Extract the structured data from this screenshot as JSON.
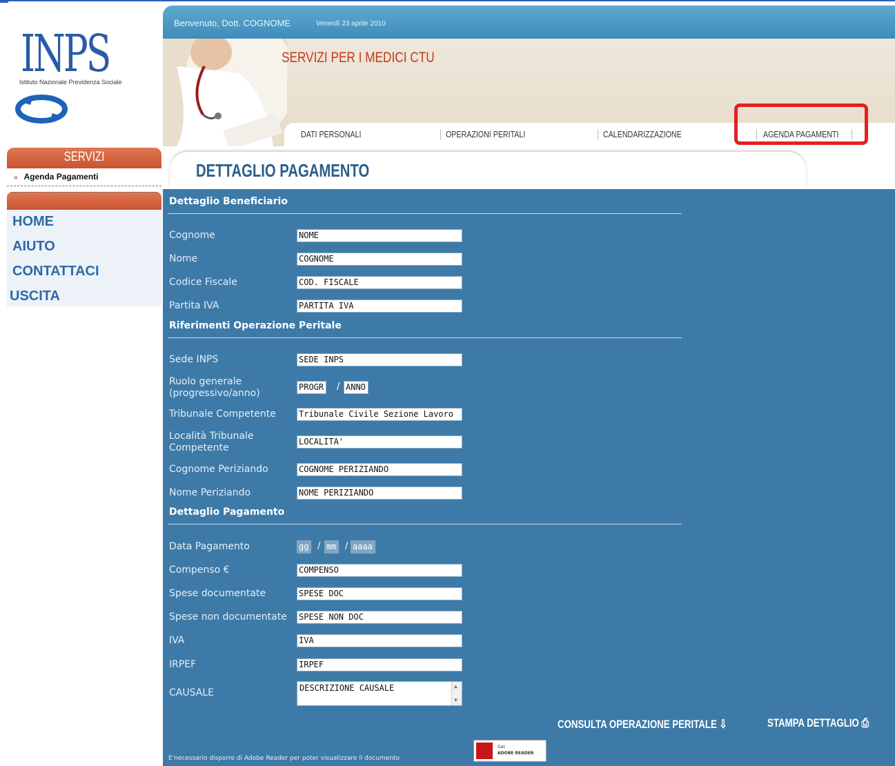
{
  "brand": {
    "logo_text": "INPS",
    "logo_subtitle": "Istituto Nazionale Previdenza Sociale"
  },
  "sidebar": {
    "section_title": "SERVIZI",
    "active_item": "Agenda Pagamenti",
    "nav": [
      "HOME",
      "AIUTO",
      "CONTATTACI",
      "USCITA"
    ]
  },
  "header": {
    "welcome": "Benvenuto, Dott. COGNOME",
    "date": "Venerdì 23 aprile 2010",
    "banner_title": "SERVIZI PER I MEDICI CTU",
    "tabs": [
      "DATI PERSONALI",
      "OPERAZIONI PERITALI",
      "CALENDARIZZAZIONE",
      "AGENDA PAGAMENTI"
    ]
  },
  "page_title": "DETTAGLIO PAGAMENTO",
  "sections": {
    "beneficiario": "Dettaglio Beneficiario",
    "riferimenti": "Riferimenti Operazione Peritale",
    "pagamento": "Dettaglio Pagamento"
  },
  "fields": {
    "cognome": {
      "label": "Cognome",
      "value": "NOME"
    },
    "nome": {
      "label": "Nome",
      "value": "COGNOME"
    },
    "codice_fiscale": {
      "label": "Codice Fiscale",
      "value": "COD. FISCALE"
    },
    "partita_iva": {
      "label": "Partita IVA",
      "value": "PARTITA IVA"
    },
    "sede_inps": {
      "label": "Sede INPS",
      "value": "SEDE INPS"
    },
    "ruolo_generale": {
      "label_1": "Ruolo generale",
      "label_2": "(progressivo/anno)",
      "value_progr": "PROGR",
      "value_anno": "ANNO"
    },
    "tribunale": {
      "label": "Tribunale Competente",
      "value": "Tribunale Civile Sezione Lavoro"
    },
    "localita": {
      "label_1": "Località Tribunale",
      "label_2": "Competente",
      "value": "LOCALITA'"
    },
    "cognome_periziando": {
      "label": "Cognome Periziando",
      "value": "COGNOME PERIZIANDO"
    },
    "nome_periziando": {
      "label": "Nome Periziando",
      "value": "NOME PERIZIANDO"
    },
    "data_pagamento": {
      "label": "Data Pagamento",
      "dd": "gg",
      "mm": "mm",
      "yyyy": "aaaa"
    },
    "compenso": {
      "label": "Compenso €",
      "value": "COMPENSO"
    },
    "spese_doc": {
      "label": "Spese documentate",
      "value": "SPESE DOC"
    },
    "spese_non_doc": {
      "label": "Spese non documentate",
      "value": "SPESE NON DOC"
    },
    "iva": {
      "label": "IVA",
      "value": "IVA"
    },
    "irpef": {
      "label": "IRPEF",
      "value": "IRPEF"
    },
    "causale": {
      "label": "CAUSALE",
      "value": "DESCRIZIONE CAUSALE"
    }
  },
  "actions": {
    "consulta": "CONSULTA OPERAZIONE PERITALE",
    "stampa": "STAMPA DETTAGLIO"
  },
  "footer": {
    "note": "E'necessario disporre di Adobe Reader per poter visualizzare il documento",
    "badge_line1": "Get",
    "badge_line2": "ADOBE READER"
  },
  "colors": {
    "panel": "#3d7aa8",
    "accent_red": "#c9532f",
    "highlight": "#e61f1f",
    "nav_blue": "#2e6aa6"
  }
}
